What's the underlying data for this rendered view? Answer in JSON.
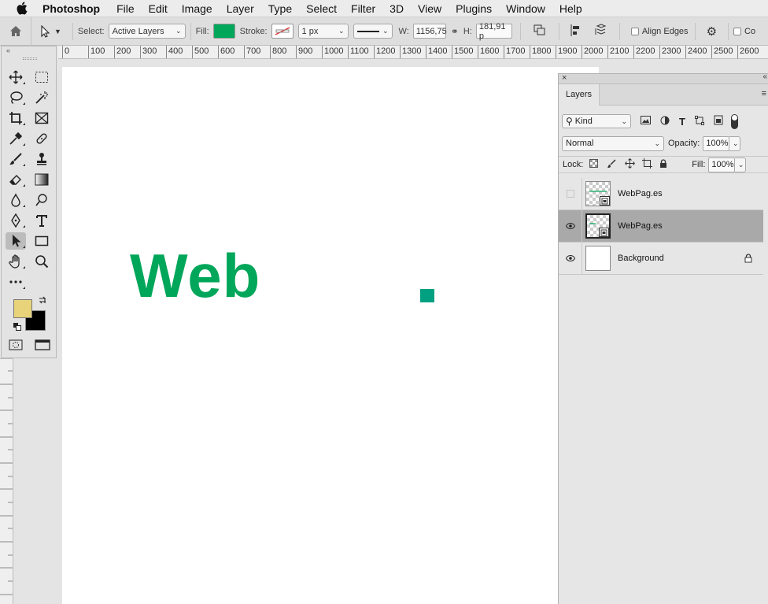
{
  "menubar": {
    "app_name": "Photoshop",
    "items": [
      "File",
      "Edit",
      "Image",
      "Layer",
      "Type",
      "Select",
      "Filter",
      "3D",
      "View",
      "Plugins",
      "Window",
      "Help"
    ]
  },
  "options": {
    "select_label": "Select:",
    "select_value": "Active Layers",
    "fill_label": "Fill:",
    "fill_color": "#00a65a",
    "stroke_label": "Stroke:",
    "stroke_width": "1 px",
    "w_label": "W:",
    "w_value": "1156,75",
    "h_label": "H:",
    "h_value": "181,91 p",
    "align_edges": "Align Edges",
    "truncated_option": "Co"
  },
  "ruler": {
    "ticks": [
      "0",
      "100",
      "200",
      "300",
      "400",
      "500",
      "600",
      "700",
      "800",
      "900",
      "1000",
      "1100",
      "1200",
      "1300",
      "1400",
      "1500",
      "1600",
      "1700",
      "1800",
      "1900",
      "2000",
      "2100",
      "2200",
      "2300",
      "2400",
      "2500",
      "2600"
    ]
  },
  "canvas": {
    "text": "Web",
    "text_color": "#00a65a",
    "dot_color": "#00a080"
  },
  "colors": {
    "foreground": "#e8d37a",
    "background": "#000000"
  },
  "layers_panel": {
    "tab": "Layers",
    "filter_kind": "Kind",
    "blend_mode": "Normal",
    "opacity_label": "Opacity:",
    "opacity_value": "100%",
    "lock_label": "Lock:",
    "fill_label": "Fill:",
    "fill_value": "100%",
    "layers": [
      {
        "name": "WebPag.es",
        "visible": false,
        "selected": false
      },
      {
        "name": "WebPag.es",
        "visible": true,
        "selected": true
      },
      {
        "name": "Background",
        "visible": true,
        "selected": false,
        "locked": true
      }
    ]
  }
}
